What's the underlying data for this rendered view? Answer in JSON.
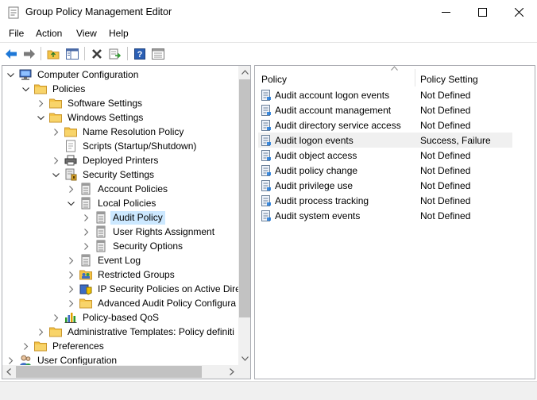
{
  "window": {
    "title": "Group Policy Management Editor"
  },
  "menu": [
    "File",
    "Action",
    "View",
    "Help"
  ],
  "tree": [
    {
      "label": "Computer Configuration",
      "level": 0,
      "expander": "expanded",
      "icon": "computer-icon"
    },
    {
      "label": "Policies",
      "level": 1,
      "expander": "expanded",
      "icon": "folder-icon"
    },
    {
      "label": "Software Settings",
      "level": 2,
      "expander": "collapsed",
      "icon": "folder-icon"
    },
    {
      "label": "Windows Settings",
      "level": 2,
      "expander": "expanded",
      "icon": "folder-icon"
    },
    {
      "label": "Name Resolution Policy",
      "level": 3,
      "expander": "collapsed",
      "icon": "folder-icon"
    },
    {
      "label": "Scripts (Startup/Shutdown)",
      "level": 3,
      "expander": "none",
      "icon": "script-icon"
    },
    {
      "label": "Deployed Printers",
      "level": 3,
      "expander": "collapsed",
      "icon": "printer-icon"
    },
    {
      "label": "Security Settings",
      "level": 3,
      "expander": "expanded",
      "icon": "security-settings-icon"
    },
    {
      "label": "Account Policies",
      "level": 4,
      "expander": "collapsed",
      "icon": "policy-icon"
    },
    {
      "label": "Local Policies",
      "level": 4,
      "expander": "expanded",
      "icon": "policy-icon"
    },
    {
      "label": "Audit Policy",
      "level": 5,
      "expander": "collapsed",
      "icon": "policy-icon",
      "selected": true
    },
    {
      "label": "User Rights Assignment",
      "level": 5,
      "expander": "collapsed",
      "icon": "policy-icon"
    },
    {
      "label": "Security Options",
      "level": 5,
      "expander": "collapsed",
      "icon": "policy-icon"
    },
    {
      "label": "Event Log",
      "level": 4,
      "expander": "collapsed",
      "icon": "policy-icon"
    },
    {
      "label": "Restricted Groups",
      "level": 4,
      "expander": "collapsed",
      "icon": "restricted-groups-icon"
    },
    {
      "label": "IP Security Policies on Active Direc",
      "level": 4,
      "expander": "collapsed",
      "icon": "ipsec-icon"
    },
    {
      "label": "Advanced Audit Policy Configura",
      "level": 4,
      "expander": "collapsed",
      "icon": "folder-icon"
    },
    {
      "label": "Policy-based QoS",
      "level": 3,
      "expander": "collapsed",
      "icon": "qos-chart-icon"
    },
    {
      "label": "Administrative Templates: Policy definiti",
      "level": 2,
      "expander": "collapsed",
      "icon": "folder-icon"
    },
    {
      "label": "Preferences",
      "level": 1,
      "expander": "collapsed",
      "icon": "folder-icon"
    },
    {
      "label": "User Configuration",
      "level": 0,
      "expander": "collapsed",
      "icon": "users-icon"
    }
  ],
  "list": {
    "headers": [
      "Policy",
      "Policy Setting"
    ],
    "rows": [
      {
        "policy": "Audit account logon events",
        "setting": "Not Defined"
      },
      {
        "policy": "Audit account management",
        "setting": "Not Defined"
      },
      {
        "policy": "Audit directory service access",
        "setting": "Not Defined"
      },
      {
        "policy": "Audit logon events",
        "setting": "Success, Failure",
        "highlighted": true
      },
      {
        "policy": "Audit object access",
        "setting": "Not Defined"
      },
      {
        "policy": "Audit policy change",
        "setting": "Not Defined"
      },
      {
        "policy": "Audit privilege use",
        "setting": "Not Defined"
      },
      {
        "policy": "Audit process tracking",
        "setting": "Not Defined"
      },
      {
        "policy": "Audit system events",
        "setting": "Not Defined"
      }
    ]
  },
  "colors": {
    "selection": "#cce8ff",
    "row_highlight": "#f0f0f0",
    "toolbar_arrow": "#1e78d7",
    "folder": "#f5c446"
  }
}
